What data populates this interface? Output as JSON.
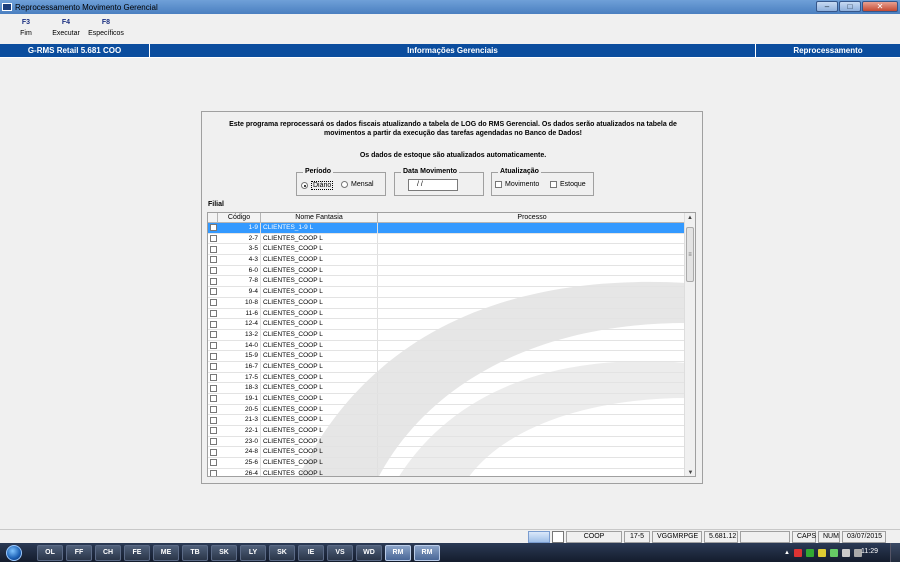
{
  "window": {
    "title": "Reprocessamento Movimento Gerencial",
    "buttons": [
      "–",
      "□",
      "✕"
    ]
  },
  "toolbar": [
    {
      "key": "F3",
      "label": "Fim"
    },
    {
      "key": "F4",
      "label": "Executar"
    },
    {
      "key": "F8",
      "label": "Específicos"
    }
  ],
  "header": {
    "left": "G-RMS Retail 5.681 COO",
    "center": "Informações Gerenciais",
    "right": "Reprocessamento"
  },
  "intro": {
    "line1": "Este programa reprocessará os dados fiscais atualizando a tabela de LOG do RMS Gerencial. Os dados serão atualizados na tabela de",
    "line2": "movimentos a partir da execução das tarefas agendadas no Banco de Dados!",
    "note": "Os dados de estoque são atualizados automaticamente."
  },
  "periodo": {
    "title": "Período",
    "options": [
      "Diário",
      "Mensal"
    ],
    "selected": "Diário"
  },
  "data_movimento": {
    "title": "Data Movimento",
    "value": " / /"
  },
  "atualizacao": {
    "title": "Atualização",
    "options": [
      "Movimento",
      "Estoque"
    ]
  },
  "filial": {
    "label": "Filial",
    "columns": [
      "Código",
      "Nome Fantasia",
      "Processo"
    ],
    "rows": [
      {
        "codigo": "1-9",
        "nome": "CLIENTES_1-9 L",
        "selected": true
      },
      {
        "codigo": "2-7",
        "nome": "CLIENTES_COOP L"
      },
      {
        "codigo": "3-5",
        "nome": "CLIENTES_COOP L"
      },
      {
        "codigo": "4-3",
        "nome": "CLIENTES_COOP L"
      },
      {
        "codigo": "6-0",
        "nome": "CLIENTES_COOP L"
      },
      {
        "codigo": "7-8",
        "nome": "CLIENTES_COOP L"
      },
      {
        "codigo": "9-4",
        "nome": "CLIENTES_COOP L"
      },
      {
        "codigo": "10-8",
        "nome": "CLIENTES_COOP L"
      },
      {
        "codigo": "11-6",
        "nome": "CLIENTES_COOP L"
      },
      {
        "codigo": "12-4",
        "nome": "CLIENTES_COOP L"
      },
      {
        "codigo": "13-2",
        "nome": "CLIENTES_COOP L"
      },
      {
        "codigo": "14-0",
        "nome": "CLIENTES_COOP L"
      },
      {
        "codigo": "15-9",
        "nome": "CLIENTES_COOP L"
      },
      {
        "codigo": "16-7",
        "nome": "CLIENTES_COOP L"
      },
      {
        "codigo": "17-5",
        "nome": "CLIENTES_COOP L"
      },
      {
        "codigo": "18-3",
        "nome": "CLIENTES_COOP L"
      },
      {
        "codigo": "19-1",
        "nome": "CLIENTES_COOP L"
      },
      {
        "codigo": "20-5",
        "nome": "CLIENTES_COOP L"
      },
      {
        "codigo": "21-3",
        "nome": "CLIENTES_COOP L"
      },
      {
        "codigo": "22-1",
        "nome": "CLIENTES_COOP L"
      },
      {
        "codigo": "23-0",
        "nome": "CLIENTES_COOP L"
      },
      {
        "codigo": "24-8",
        "nome": "CLIENTES_COOP L"
      },
      {
        "codigo": "25-6",
        "nome": "CLIENTES_COOP L"
      },
      {
        "codigo": "26-4",
        "nome": "CLIENTES_COOP L"
      }
    ]
  },
  "statusbar": [
    "COOP",
    "17-5",
    "VGGMRPGE",
    "5.681.12",
    "",
    "CAPS",
    "NUM",
    "03/07/2015"
  ],
  "taskbar": {
    "clock": "11:29",
    "apps": [
      "OL",
      "FF",
      "CH",
      "FE",
      "ME",
      "TB",
      "SK",
      "LY",
      "SK",
      "IE",
      "VS",
      "WD",
      "RM",
      "RM"
    ]
  }
}
